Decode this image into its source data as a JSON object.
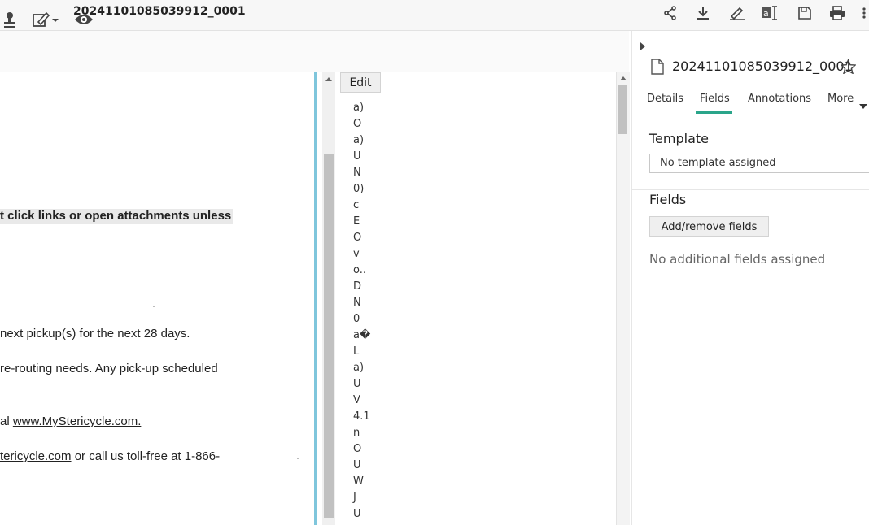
{
  "header": {
    "doc_title": "20241101085039912_0001"
  },
  "document": {
    "lines": [
      "t click links or open attachments unless",
      "next pickup(s) for the next 28 days.",
      " re-routing needs. Any pick-up scheduled",
      "al ",
      "tericycle.com"
    ],
    "link_1": "www.MyStericycle.com.",
    "line_6_suffix": " or call us toll-free at 1-866-"
  },
  "text_panel": {
    "edit_label": "Edit",
    "ocr_lines": [
      "a)",
      "O",
      "a)",
      "U",
      "N",
      "0)",
      "c",
      "E",
      "O",
      "v",
      "o..",
      "D",
      "N",
      "0",
      "a�",
      "L",
      "a)",
      "U",
      "V",
      "4.1",
      "n",
      "O",
      "U",
      "W",
      "J",
      "U"
    ]
  },
  "side_panel": {
    "title": "20241101085039912_0001",
    "tabs": [
      "Details",
      "Fields",
      "Annotations",
      "More"
    ],
    "active_tab": "Fields",
    "template_heading": "Template",
    "template_value": "No template assigned",
    "fields_heading": "Fields",
    "add_remove_label": "Add/remove fields",
    "no_fields_text": "No additional fields assigned"
  },
  "colors": {
    "accent": "#2aa58a",
    "divider": "#7fc6dc"
  }
}
